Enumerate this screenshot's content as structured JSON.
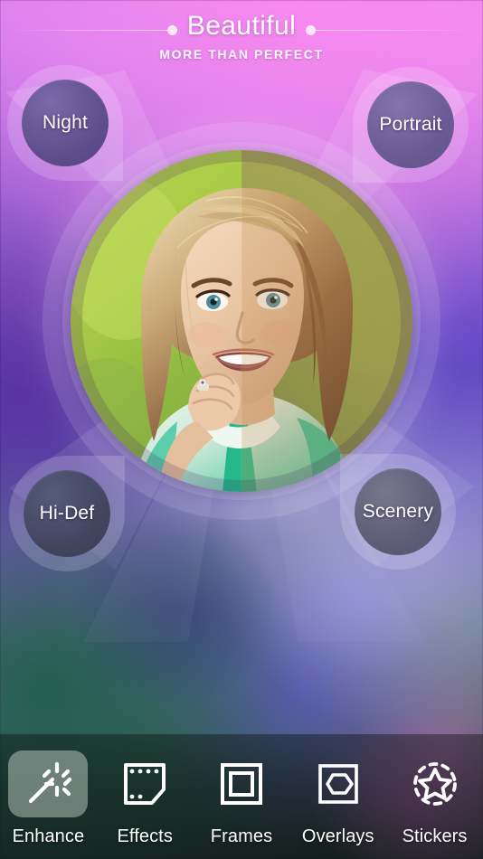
{
  "app": {
    "title": "Beautiful",
    "subtitle": "MORE THAN PERFECT"
  },
  "colors": {
    "title_text": "#ffffff",
    "toolbar_bg": "#0a1410",
    "selected_tile": "#e2ece2",
    "bubble_night": "#5f4e8c",
    "bubble_portrait": "#6a5b94",
    "bubble_hidef": "#43455f",
    "bubble_scenery": "#5d5d78",
    "background_top": "#e27bf0",
    "background_mid": "#5c48ae",
    "background_bottom": "#25352f"
  },
  "hub": {
    "name": "photo-preview",
    "description": "circular portrait preview with filter split"
  },
  "filter_bubbles": [
    {
      "id": "night",
      "label": "Night",
      "position": "top-left"
    },
    {
      "id": "portrait",
      "label": "Portrait",
      "position": "top-right"
    },
    {
      "id": "hidef",
      "label": "Hi-Def",
      "position": "bottom-left"
    },
    {
      "id": "scenery",
      "label": "Scenery",
      "position": "bottom-right"
    }
  ],
  "toolbar": {
    "items": [
      {
        "id": "enhance",
        "label": "Enhance",
        "icon": "magic-wand-icon",
        "selected": true
      },
      {
        "id": "effects",
        "label": "Effects",
        "icon": "film-frame-icon",
        "selected": false
      },
      {
        "id": "frames",
        "label": "Frames",
        "icon": "nested-square-icon",
        "selected": false
      },
      {
        "id": "overlays",
        "label": "Overlays",
        "icon": "hexagon-square-icon",
        "selected": false
      },
      {
        "id": "stickers",
        "label": "Stickers",
        "icon": "star-dashed-icon",
        "selected": false
      }
    ]
  }
}
